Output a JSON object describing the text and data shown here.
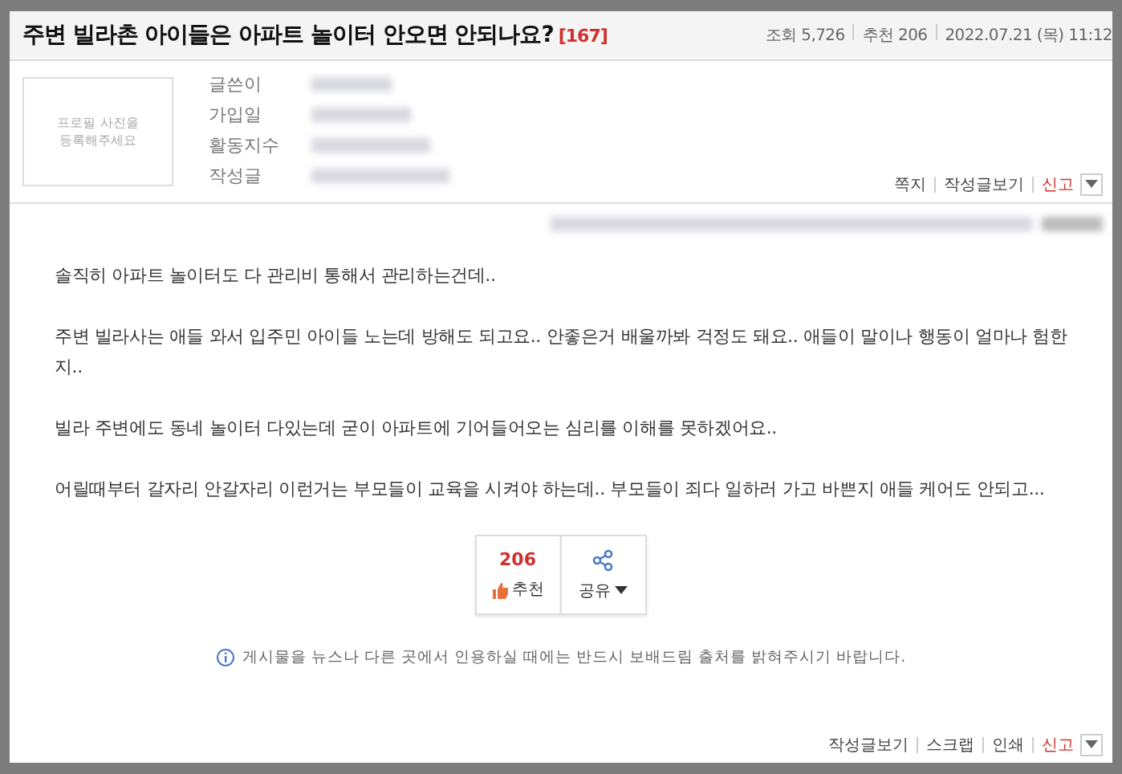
{
  "post": {
    "title": "주변 빌라촌 아이들은 아파트 놀이터 안오면 안되나요?",
    "comment_count": "[167]",
    "meta": [
      "조회 5,726",
      "추천 206",
      "2022.07.21 (목) 11:12"
    ]
  },
  "profile": {
    "photo_placeholder": "프로필 사진을\n등록해주세요",
    "fields": [
      "글쓴이",
      "가입일",
      "활동지수",
      "작성글"
    ],
    "actions": [
      {
        "label": "쪽지",
        "kind": "normal"
      },
      {
        "label": "작성글보기",
        "kind": "normal"
      },
      {
        "label": "신고",
        "kind": "alert"
      }
    ]
  },
  "body": [
    "솔직히 아파트 놀이터도 다 관리비 통해서 관리하는건데..",
    "주변 빌라사는 애들 와서 입주민 아이들 노는데 방해도 되고요.. 안좋은거 배울까봐 걱정도 돼요.. 애들이 말이나 행동이 얼마나 험한지..",
    "빌라 주변에도 동네 놀이터 다있는데 굳이 아파트에 기어들어오는 심리를 이해를 못하겠어요..",
    "어릴때부터 갈자리 안갈자리 이런거는 부모들이 교육을 시켜야 하는데.. 부모들이 죄다 일하러 가고 바쁜지 애들 케어도 안되고..."
  ],
  "recommend": {
    "count": "206",
    "label": "추천"
  },
  "share": {
    "label": "공유"
  },
  "notice": "게시물을 뉴스나 다른 곳에서 인용하실 때에는 반드시 보배드림 출처를 밝혀주시기 바랍니다.",
  "footer_actions": [
    {
      "label": "작성글보기",
      "kind": "normal"
    },
    {
      "label": "스크랩",
      "kind": "normal"
    },
    {
      "label": "인쇄",
      "kind": "normal"
    },
    {
      "label": "신고",
      "kind": "alert"
    }
  ]
}
